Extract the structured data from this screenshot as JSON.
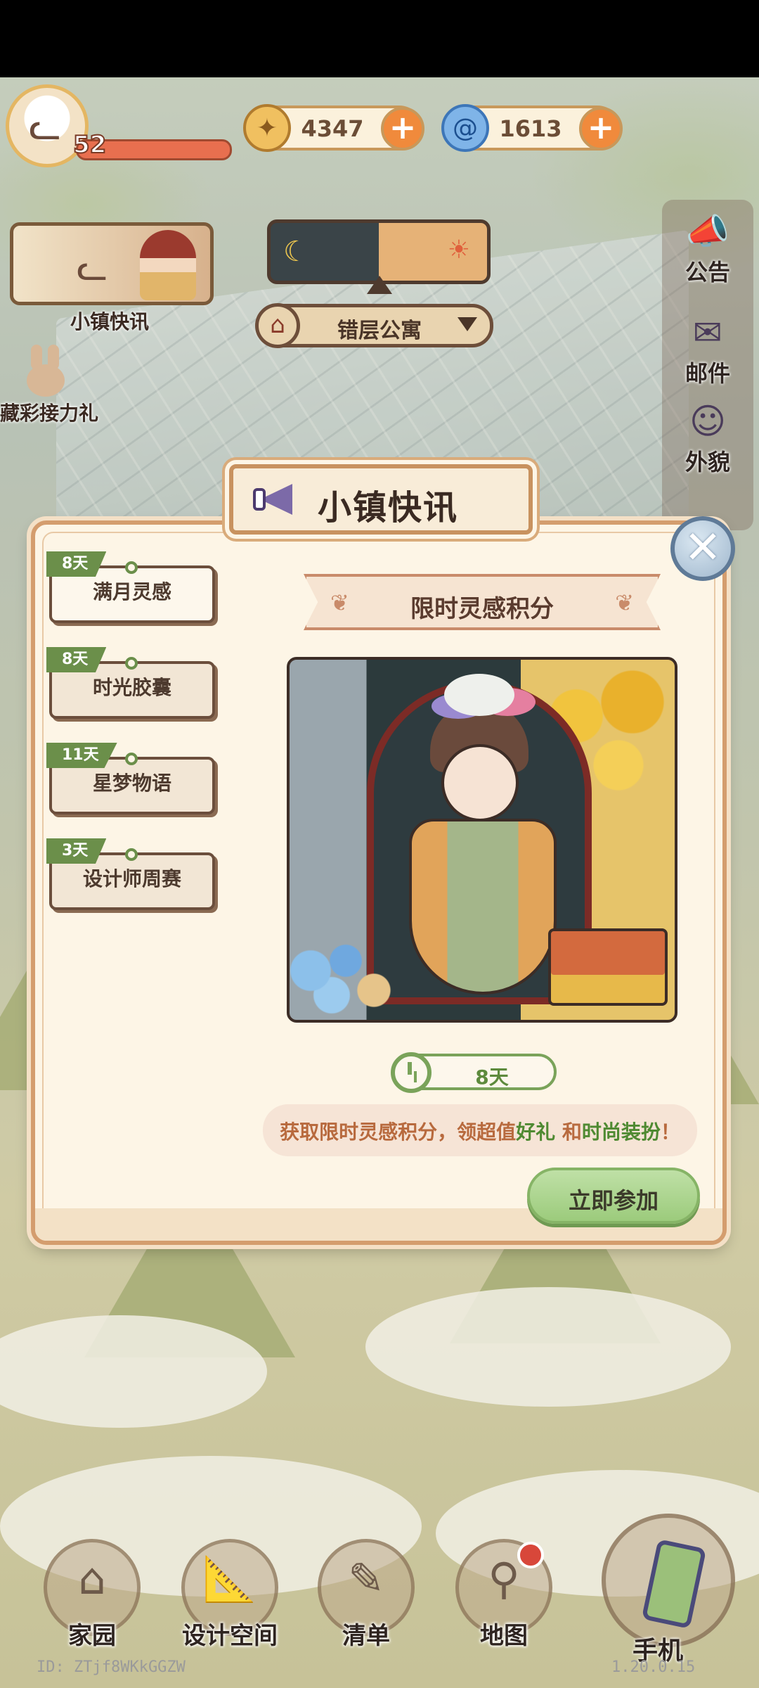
{
  "hud": {
    "level": "52",
    "currency_coin": "4347",
    "currency_spiral": "1613",
    "card_label": "小镇快讯",
    "bunny_label": "藏彩接力礼",
    "location": "错层公寓"
  },
  "side_menu": {
    "announcement": "公告",
    "mail": "邮件",
    "appearance": "外貌"
  },
  "modal": {
    "title": "小镇快讯",
    "close_symbol": "✕",
    "tabs": [
      {
        "badge": "8天",
        "label": "满月灵感"
      },
      {
        "badge": "8天",
        "label": "时光胶囊"
      },
      {
        "badge": "11天",
        "label": "星梦物语"
      },
      {
        "badge": "3天",
        "label": "设计师周赛"
      }
    ],
    "event_title": "限时灵感积分",
    "timer": "8天",
    "description_parts": [
      "获取限时灵感积分，领超值",
      "好礼",
      " 和",
      "时尚装扮",
      "！"
    ],
    "join_button": "立即参加"
  },
  "bottom_nav": {
    "home": "家园",
    "design": "设计空间",
    "list": "清单",
    "map": "地图",
    "phone": "手机"
  },
  "footer": {
    "id": "ID: ZTjf8WKkGGZW",
    "version": "1.20.0.15"
  },
  "icons": {
    "coin": "coin-icon",
    "spiral": "spiral-icon",
    "plus": "plus-icon",
    "megaphone": "megaphone-icon",
    "clock": "clock-icon",
    "close": "close-icon",
    "home": "house-icon",
    "map": "map-pin-icon",
    "phone": "phone-icon"
  },
  "colors": {
    "accent_green": "#7aa35a",
    "badge_green": "#6b8f4a",
    "plus_orange": "#f08a3c",
    "title_brown": "#3a2a22",
    "notification_red": "#d8473a"
  }
}
